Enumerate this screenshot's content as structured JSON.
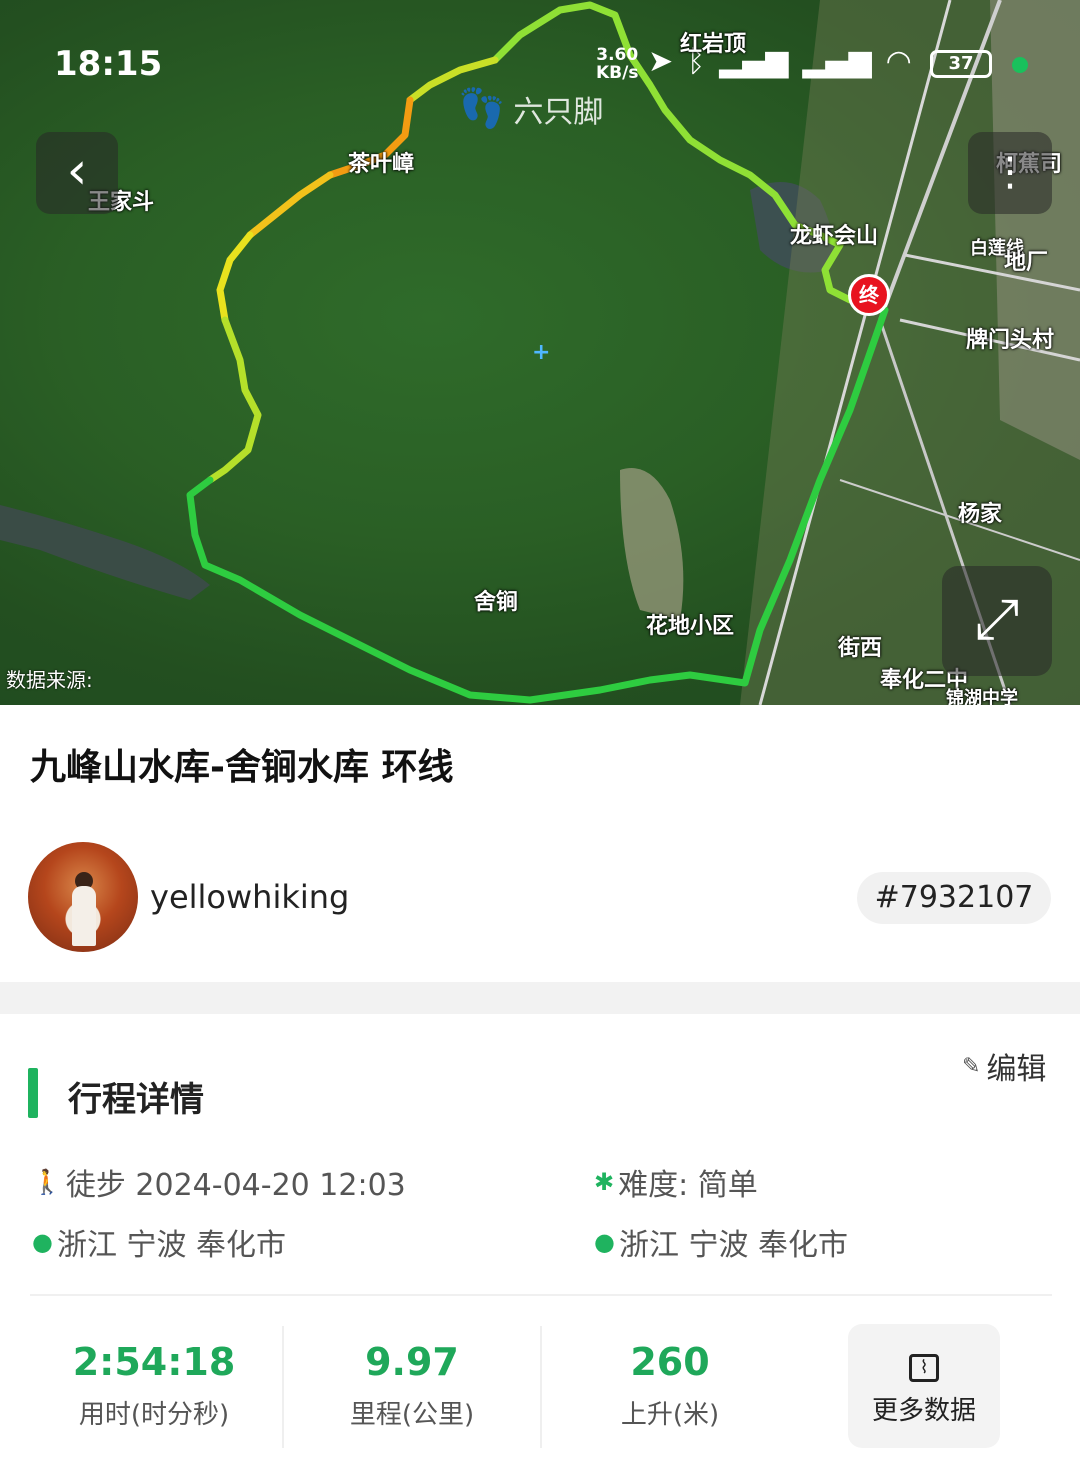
{
  "status_bar": {
    "time": "18:15",
    "net_speed": "3.60\nKB/s",
    "battery": "37"
  },
  "map": {
    "brand": "六只脚",
    "source_label": "数据来源:",
    "end_marker": "终",
    "labels": [
      {
        "text": "王家斗"
      },
      {
        "text": "茶叶嶂"
      },
      {
        "text": "红岩顶"
      },
      {
        "text": "柯蕉司"
      },
      {
        "text": "龙虾会山"
      },
      {
        "text": "白莲线"
      },
      {
        "text": "地厂"
      },
      {
        "text": "牌门头村"
      },
      {
        "text": "杨家"
      },
      {
        "text": "舍锏"
      },
      {
        "text": "花地小区"
      },
      {
        "text": "街西"
      },
      {
        "text": "奉化二中"
      },
      {
        "text": "锦湖中学"
      }
    ],
    "track_colors": {
      "green": "#2ecc40",
      "lime": "#9be22d",
      "yellow": "#f2d21b",
      "orange": "#f39c12"
    }
  },
  "track": {
    "title": "九峰山水库-舍锏水库 环线",
    "username": "yellowhiking",
    "track_id": "#7932107"
  },
  "details": {
    "section_title": "行程详情",
    "edit_label": "编辑",
    "activity": "徒步 2024-04-20 12:03",
    "difficulty": "难度: 简单",
    "start_location": "浙江 宁波 奉化市",
    "end_location": "浙江 宁波 奉化市"
  },
  "stats": {
    "duration_value": "2:54:18",
    "duration_label": "用时(时分秒)",
    "distance_value": "9.97",
    "distance_label": "里程(公里)",
    "ascent_value": "260",
    "ascent_label": "上升(米)",
    "more_label": "更多数据"
  },
  "colors": {
    "accent": "#1fb35f",
    "stat_value": "#1fa85a",
    "end_marker": "#e8131f"
  }
}
